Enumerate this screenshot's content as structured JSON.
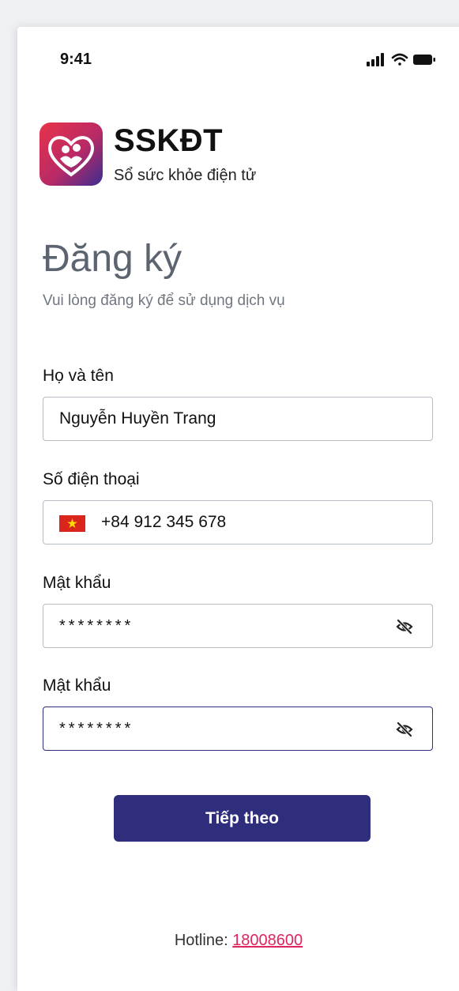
{
  "status_bar": {
    "time": "9:41"
  },
  "brand": {
    "name": "SSKĐT",
    "tagline": "Sổ sức khỏe điện tử"
  },
  "page": {
    "title": "Đăng ký",
    "subtitle": "Vui lòng đăng ký để sử dụng dịch vụ"
  },
  "form": {
    "full_name": {
      "label": "Họ và tên",
      "value": "Nguyễn Huyền Trang"
    },
    "phone": {
      "label": "Số điện thoại",
      "value": "+84 912 345 678"
    },
    "password": {
      "label": "Mật khẩu",
      "value": "********"
    },
    "confirm_password": {
      "label": "Mật khẩu",
      "value": "********"
    }
  },
  "submit": {
    "label": "Tiếp theo"
  },
  "footer": {
    "hotline_label": "Hotline:",
    "hotline_number": "18008600"
  },
  "colors": {
    "primary": "#2f2e7d",
    "accent": "#e0245e",
    "logo_top": "#e8334a",
    "logo_bottom": "#3a2d91"
  },
  "icons": {
    "status": [
      "signal-icon",
      "wifi-icon",
      "battery-icon"
    ],
    "password_toggle": "eye-off-icon",
    "country": "vietnam-flag-icon"
  }
}
